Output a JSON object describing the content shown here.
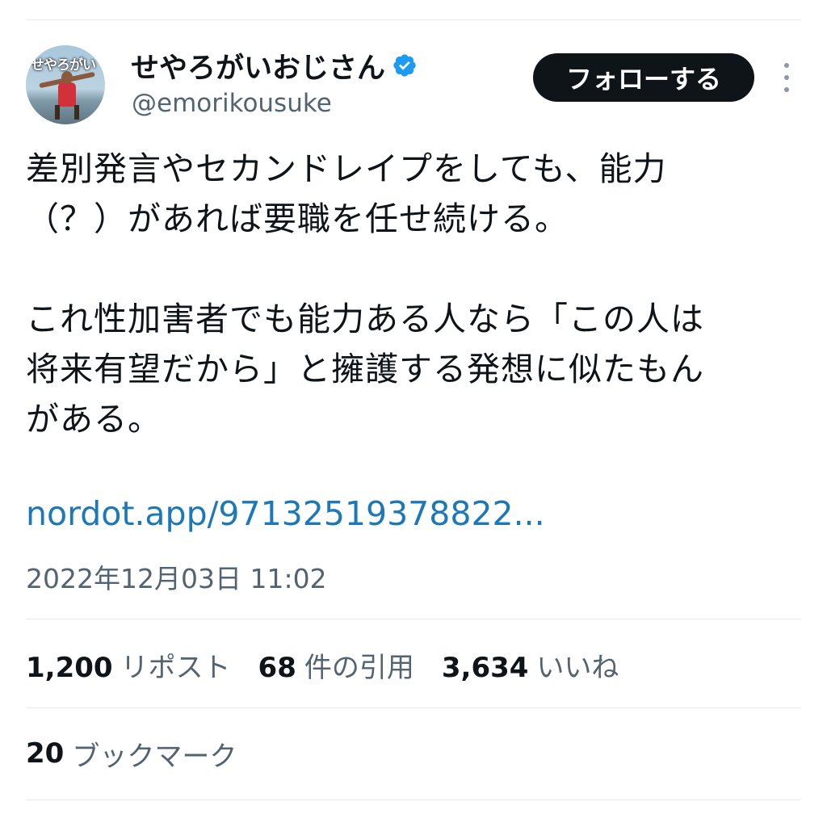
{
  "author": {
    "display_name": "せやろがいおじさん",
    "handle": "@emorikousuke",
    "avatar_text": "せやろがい",
    "verified": true,
    "verified_color": "#1d9bf0"
  },
  "header": {
    "follow_label": "フォローする",
    "more_icon": "more-vertical-icon"
  },
  "tweet": {
    "text": "差別発言やセカンドレイプをしても、能力\n（？）があれば要職を任せ続ける。\n\nこれ性加害者でも能力ある人なら「この人は\n将来有望だから」と擁護する発想に似たもん\nがある。",
    "link": "nordot.app/97132519378822...",
    "timestamp": "2022年12月03日 11:02"
  },
  "stats": {
    "reposts_count": "1,200",
    "reposts_label": "リポスト",
    "quotes_count": "68",
    "quotes_label": "件の引用",
    "likes_count": "3,634",
    "likes_label": "いいね",
    "bookmarks_count": "20",
    "bookmarks_label": "ブックマーク"
  },
  "colors": {
    "link": "#1d78b8",
    "secondary_text": "#536471",
    "follow_bg": "#0f1419"
  }
}
